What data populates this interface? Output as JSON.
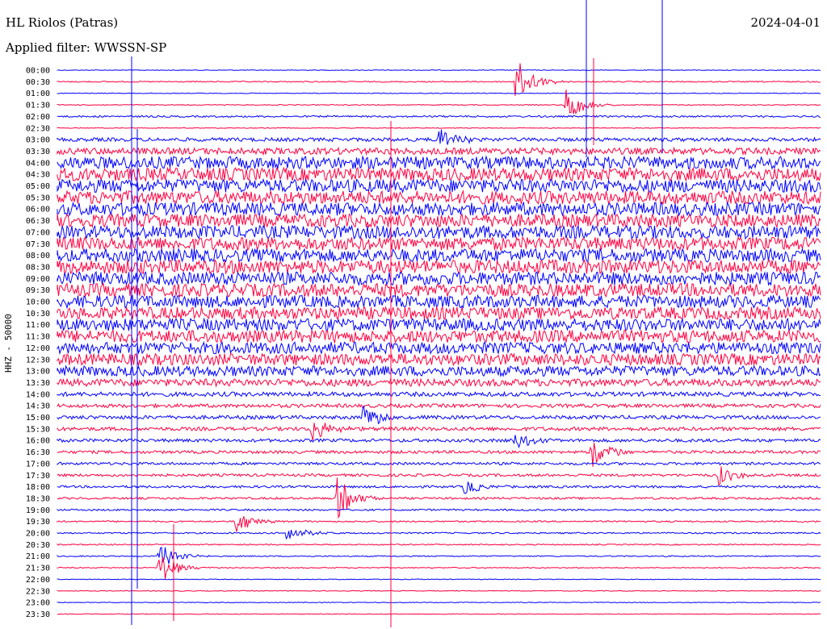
{
  "header": {
    "station": "HL Riolos (Patras)",
    "date": "2024-04-01",
    "filter": "Applied filter: WWSSN-SP"
  },
  "colors": {
    "trace_a": "#0000ff",
    "trace_b": "#ff0040"
  },
  "chart_data": {
    "type": "line",
    "title": "HL Riolos (Patras)",
    "ylabel": "HHZ - 50000",
    "xlabel": "",
    "row_labels": [
      "00:00",
      "00:30",
      "01:00",
      "01:30",
      "02:00",
      "02:30",
      "03:00",
      "03:30",
      "04:00",
      "04:30",
      "05:00",
      "05:30",
      "06:00",
      "06:30",
      "07:00",
      "07:30",
      "08:00",
      "08:30",
      "09:00",
      "09:30",
      "10:00",
      "10:30",
      "11:00",
      "11:30",
      "12:00",
      "12:30",
      "13:00",
      "13:30",
      "14:00",
      "14:30",
      "15:00",
      "15:30",
      "16:00",
      "16:30",
      "17:00",
      "17:30",
      "18:00",
      "18:30",
      "19:00",
      "19:30",
      "20:00",
      "20:30",
      "21:00",
      "21:30",
      "22:00",
      "22:30",
      "23:00",
      "23:30"
    ],
    "row_noise_level": [
      0.05,
      0.08,
      0.05,
      0.06,
      0.12,
      0.05,
      0.25,
      0.45,
      0.85,
      0.9,
      0.9,
      0.9,
      0.9,
      0.9,
      0.9,
      0.9,
      0.9,
      0.95,
      0.9,
      0.9,
      0.85,
      0.85,
      0.85,
      0.85,
      0.8,
      0.8,
      0.7,
      0.5,
      0.3,
      0.25,
      0.25,
      0.25,
      0.22,
      0.2,
      0.18,
      0.18,
      0.16,
      0.14,
      0.12,
      0.1,
      0.1,
      0.08,
      0.08,
      0.07,
      0.05,
      0.05,
      0.05,
      0.05
    ],
    "events": [
      {
        "time": "00:30",
        "minute": 18,
        "amplitude": 3.5
      },
      {
        "time": "01:30",
        "minute": 20,
        "amplitude": 2.5
      },
      {
        "time": "03:00",
        "minute": 15,
        "amplitude": 2.0
      },
      {
        "time": "15:00",
        "minute": 12,
        "amplitude": 2.0
      },
      {
        "time": "15:30",
        "minute": 10,
        "amplitude": 2.0
      },
      {
        "time": "16:00",
        "minute": 18,
        "amplitude": 1.5
      },
      {
        "time": "16:30",
        "minute": 21,
        "amplitude": 2.5
      },
      {
        "time": "17:30",
        "minute": 26,
        "amplitude": 1.5
      },
      {
        "time": "18:00",
        "minute": 16,
        "amplitude": 1.2
      },
      {
        "time": "18:30",
        "minute": 11,
        "amplitude": 3.0
      },
      {
        "time": "19:30",
        "minute": 7,
        "amplitude": 2.0
      },
      {
        "time": "20:00",
        "minute": 9,
        "amplitude": 1.5
      },
      {
        "time": "21:00",
        "minute": 4,
        "amplitude": 2.0
      },
      {
        "time": "21:30",
        "minute": 4,
        "amplitude": 2.5
      }
    ]
  }
}
